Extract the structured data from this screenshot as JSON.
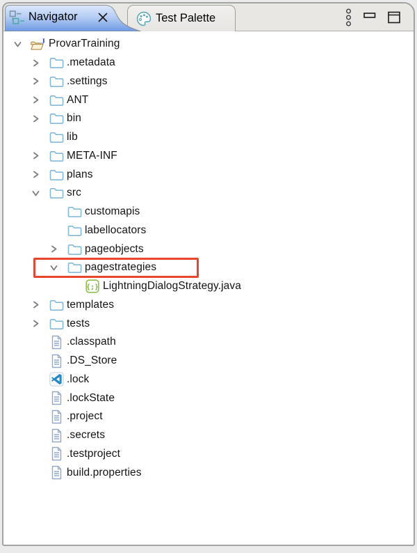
{
  "tabbar": {
    "tabs": [
      {
        "label": "Navigator",
        "active": true,
        "icon": "navigator-icon",
        "closable": true
      },
      {
        "label": "Test Palette",
        "active": false,
        "icon": "palette-icon",
        "closable": false
      }
    ]
  },
  "toolbar": {
    "icons": [
      "view-menu-icon",
      "minimize-icon",
      "maximize-icon"
    ]
  },
  "colors": {
    "active_tab_top": "#dce8fc",
    "active_tab_bottom": "#6d99e2",
    "highlight_box": "#e8462c",
    "folder_outline": "#85b9da",
    "java_source_green": "#8bc34a",
    "vscode_blue": "#2488ca",
    "tabbar_background": "#e9e7e4"
  },
  "tree": {
    "items": [
      {
        "label": "ProvarTraining",
        "depth": 0,
        "state": "expanded",
        "icon": "java-project-open"
      },
      {
        "label": ".metadata",
        "depth": 1,
        "state": "collapsed",
        "icon": "folder"
      },
      {
        "label": ".settings",
        "depth": 1,
        "state": "collapsed",
        "icon": "folder"
      },
      {
        "label": "ANT",
        "depth": 1,
        "state": "collapsed",
        "icon": "folder"
      },
      {
        "label": "bin",
        "depth": 1,
        "state": "collapsed",
        "icon": "folder"
      },
      {
        "label": "lib",
        "depth": 1,
        "state": "leaf",
        "icon": "folder"
      },
      {
        "label": "META-INF",
        "depth": 1,
        "state": "collapsed",
        "icon": "folder"
      },
      {
        "label": "plans",
        "depth": 1,
        "state": "collapsed",
        "icon": "folder"
      },
      {
        "label": "src",
        "depth": 1,
        "state": "expanded",
        "icon": "folder"
      },
      {
        "label": "customapis",
        "depth": 2,
        "state": "leaf",
        "icon": "folder"
      },
      {
        "label": "labellocators",
        "depth": 2,
        "state": "leaf",
        "icon": "folder"
      },
      {
        "label": "pageobjects",
        "depth": 2,
        "state": "collapsed",
        "icon": "folder"
      },
      {
        "label": "pagestrategies",
        "depth": 2,
        "state": "expanded",
        "icon": "folder",
        "highlighted": true
      },
      {
        "label": "LightningDialogStrategy.java",
        "depth": 3,
        "state": "leaf",
        "icon": "java-source"
      },
      {
        "label": "templates",
        "depth": 1,
        "state": "collapsed",
        "icon": "folder"
      },
      {
        "label": "tests",
        "depth": 1,
        "state": "collapsed",
        "icon": "folder"
      },
      {
        "label": ".classpath",
        "depth": 1,
        "state": "leaf",
        "icon": "file"
      },
      {
        "label": ".DS_Store",
        "depth": 1,
        "state": "leaf",
        "icon": "file"
      },
      {
        "label": ".lock",
        "depth": 1,
        "state": "leaf",
        "icon": "vscode"
      },
      {
        "label": ".lockState",
        "depth": 1,
        "state": "leaf",
        "icon": "file"
      },
      {
        "label": ".project",
        "depth": 1,
        "state": "leaf",
        "icon": "file"
      },
      {
        "label": ".secrets",
        "depth": 1,
        "state": "leaf",
        "icon": "file"
      },
      {
        "label": ".testproject",
        "depth": 1,
        "state": "leaf",
        "icon": "file"
      },
      {
        "label": "build.properties",
        "depth": 1,
        "state": "leaf",
        "icon": "file"
      }
    ]
  }
}
